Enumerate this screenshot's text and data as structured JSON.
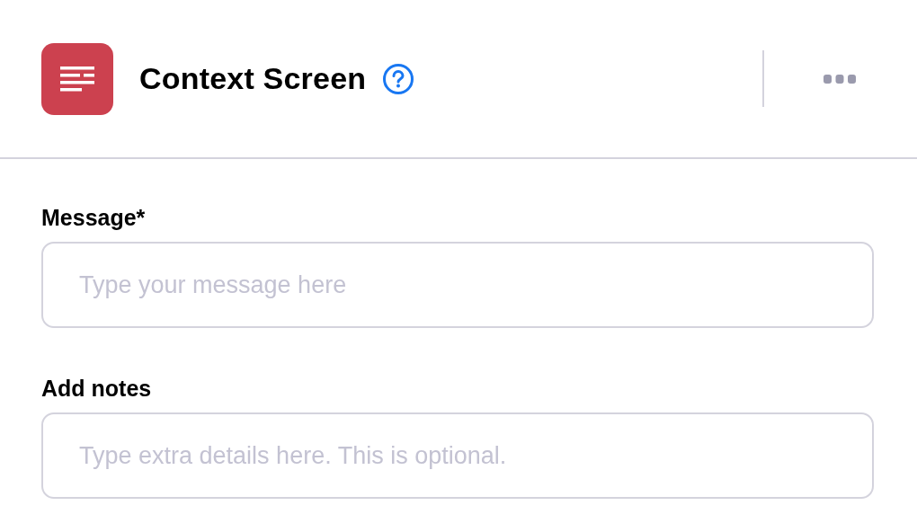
{
  "header": {
    "title": "Context Screen"
  },
  "fields": [
    {
      "label": "Message*",
      "placeholder": "Type your message here"
    },
    {
      "label": "Add notes",
      "placeholder": "Type extra details here. This is optional."
    }
  ]
}
